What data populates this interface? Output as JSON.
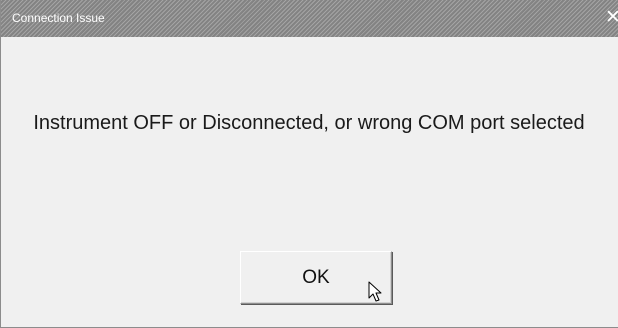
{
  "window": {
    "title": "Connection Issue",
    "close_glyph": "✕"
  },
  "dialog": {
    "message": "Instrument OFF or Disconnected, or wrong COM port selected",
    "ok_label": "OK"
  },
  "icons": {
    "close": "close-icon",
    "cursor": "mouse-pointer-icon"
  },
  "colors": {
    "background": "#f0f0f0",
    "titlebar": "#8a8a8a",
    "title_text": "#ffffff",
    "message_text": "#1a1a1a"
  }
}
